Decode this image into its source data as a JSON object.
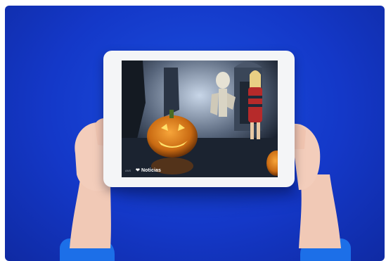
{
  "scene": {
    "background_color": "#1438c8",
    "tablet_frame_color": "#f4f5f7",
    "sleeve_color": "#1c6fe8",
    "screen": {
      "logo_text": "Noticias",
      "logo_icon": "heart-icon",
      "small_tag": "ANS"
    }
  }
}
